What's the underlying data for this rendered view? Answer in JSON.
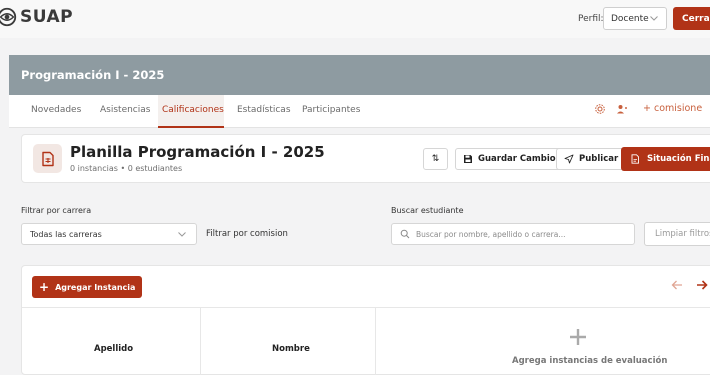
{
  "app": {
    "name": "SUAP"
  },
  "header": {
    "perfil_label": "Perfil:",
    "perfil_value": "Docente",
    "logout_label": "Cerrar"
  },
  "course": {
    "title": "Programación I - 2025",
    "tabs": [
      {
        "label": "Novedades",
        "active": false
      },
      {
        "label": "Asistencias",
        "active": false
      },
      {
        "label": "Calificaciones",
        "active": true
      },
      {
        "label": "Estadísticas",
        "active": false
      },
      {
        "label": "Participantes",
        "active": false
      }
    ],
    "comisiones_label": "+ comisione"
  },
  "planilla": {
    "title": "Planilla Programación I - 2025",
    "subtitle": "0 instancias • 0 estudiantes",
    "sort_label": "⇅",
    "save_label": "Guardar Cambios",
    "publish_label": "Publicar",
    "final_label": "Situación Final"
  },
  "filters": {
    "carrera_label": "Filtrar por carrera",
    "carrera_value": "Todas las carreras",
    "comision_label": "Filtrar por comision",
    "search_label": "Buscar estudiante",
    "search_placeholder": "Buscar por nombre, apellido o carrera...",
    "clear_label": "Limpiar filtros"
  },
  "table": {
    "add_label": "Agregar Instancia",
    "columns": [
      "Apellido",
      "Nombre"
    ],
    "empty_message": "Agrega instancias de evaluación"
  },
  "colors": {
    "accent": "#b13317",
    "banner": "#8e9ba1",
    "comisiones": "#c8603d"
  }
}
